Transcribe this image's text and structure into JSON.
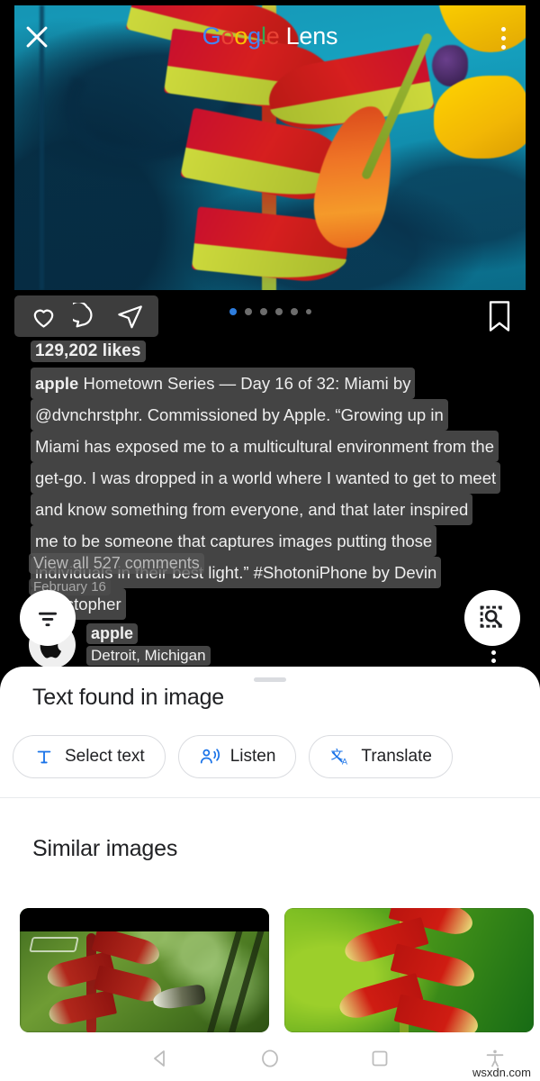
{
  "app": {
    "title_google": "Google",
    "title_lens": "Lens",
    "close_label": "Close",
    "overflow_label": "More options"
  },
  "post": {
    "likes": "129,202 likes",
    "caption_username": "apple",
    "caption_lines": [
      "Hometown Series — Day 16 of 32: Miami by",
      "@dvnchrstphr. Commissioned by Apple. “Growing up in",
      "Miami has exposed me to a multicultural environment from the",
      "get-go. I was dropped in a world where I wanted to get to meet",
      "and know something from everyone, and that later inspired",
      "me to be someone that captures images putting those",
      "individuals in their best light.” #ShotoniPhone by Devin",
      "Christopher"
    ],
    "view_comments": "View all 527 comments",
    "date": "February 16",
    "profile_name": "apple",
    "profile_location": "Detroit, Michigan",
    "carousel_total": 6,
    "carousel_active": 1,
    "actions": [
      "like-icon",
      "comment-icon",
      "share-icon"
    ],
    "bookmark": "bookmark-icon"
  },
  "fabs": {
    "filter": "filter-icon",
    "lens_search": "lens-search-icon"
  },
  "sheet": {
    "title": "Text found in image",
    "chips": [
      {
        "label": "Select text",
        "icon": "text-select-icon"
      },
      {
        "label": "Listen",
        "icon": "listen-icon"
      },
      {
        "label": "Translate",
        "icon": "translate-icon"
      }
    ],
    "similar_title": "Similar images",
    "similar_images": [
      {
        "alt": "Heliconia with hummingbird on green background"
      },
      {
        "alt": "Red heliconia flower on green background"
      }
    ]
  },
  "navbar": {
    "back": "back-triangle-icon",
    "home": "home-circle-icon",
    "recents": "recents-square-icon",
    "accessibility": "accessibility-icon"
  },
  "watermark": "wsxdn.com",
  "colors": {
    "accent_blue": "#1a73e8",
    "carousel_active": "#2e7ddd",
    "sheet_bg": "#FFFFFF",
    "app_bg": "#000000",
    "text_primary": "#202124"
  }
}
